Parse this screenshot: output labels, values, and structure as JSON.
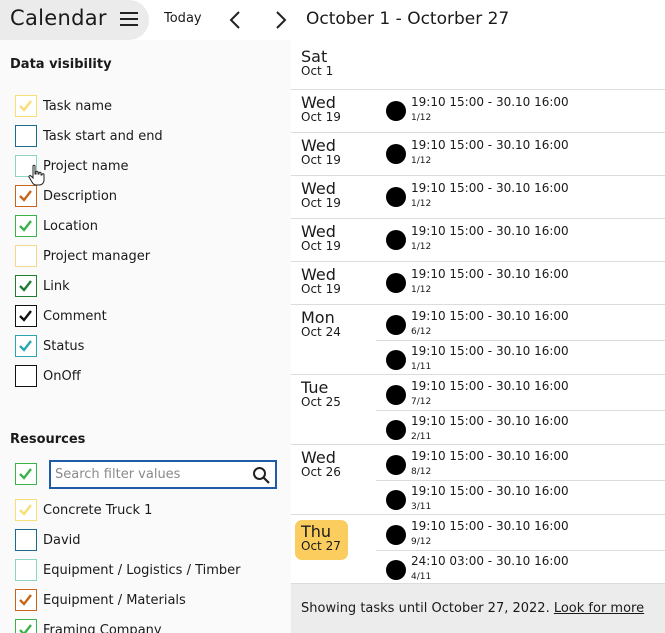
{
  "header": {
    "app_title": "Calendar",
    "today_label": "Today",
    "date_range": "October 1 - Octorber 27",
    "menu_icon": "hamburger-icon",
    "prev_icon": "chevron-left-icon",
    "next_icon": "chevron-right-icon"
  },
  "data_visibility": {
    "title": "Data visibility",
    "items": [
      {
        "label": "Task name",
        "checked": true,
        "color": "#f7df75"
      },
      {
        "label": "Task start and end",
        "checked": false,
        "color": "#1b6b8a"
      },
      {
        "label": "Project name",
        "checked": false,
        "color": "#8ad5c3"
      },
      {
        "label": "Description",
        "checked": true,
        "color": "#c8651b"
      },
      {
        "label": "Location",
        "checked": true,
        "color": "#3bb34a"
      },
      {
        "label": "Project manager",
        "checked": false,
        "color": "#f5d78a"
      },
      {
        "label": "Link",
        "checked": true,
        "color": "#1e7d32"
      },
      {
        "label": "Comment",
        "checked": true,
        "color": "#111111"
      },
      {
        "label": "Status",
        "checked": true,
        "color": "#2aa6b0"
      },
      {
        "label": "OnOff",
        "checked": false,
        "color": "#111111"
      }
    ]
  },
  "resources": {
    "title": "Resources",
    "select_all_checked": true,
    "select_all_color": "#3bb34a",
    "search_placeholder": "Search filter values",
    "search_icon": "search-icon",
    "items": [
      {
        "label": "Concrete Truck 1",
        "checked": true,
        "color": "#f7df75"
      },
      {
        "label": "David",
        "checked": false,
        "color": "#1b6b8a"
      },
      {
        "label": "Equipment / Logistics / Timber",
        "checked": false,
        "color": "#8ad5c3"
      },
      {
        "label": "Equipment / Materials",
        "checked": true,
        "color": "#c8651b"
      },
      {
        "label": "Framing Company",
        "checked": true,
        "color": "#3bb34a"
      }
    ]
  },
  "agenda": {
    "days": [
      {
        "weekday": "Sat",
        "date": "Oct 1",
        "today": false,
        "tasks": []
      },
      {
        "weekday": "Wed",
        "date": "Oct 19",
        "today": false,
        "tasks": [
          {
            "time": "19:10 15:00 - 30.10 16:00",
            "count": "1/12"
          }
        ]
      },
      {
        "weekday": "Wed",
        "date": "Oct 19",
        "today": false,
        "tasks": [
          {
            "time": "19:10 15:00 - 30.10 16:00",
            "count": "1/12"
          }
        ]
      },
      {
        "weekday": "Wed",
        "date": "Oct 19",
        "today": false,
        "tasks": [
          {
            "time": "19:10 15:00 - 30.10 16:00",
            "count": "1/12"
          }
        ]
      },
      {
        "weekday": "Wed",
        "date": "Oct 19",
        "today": false,
        "tasks": [
          {
            "time": "19:10 15:00 - 30.10 16:00",
            "count": "1/12"
          }
        ]
      },
      {
        "weekday": "Wed",
        "date": "Oct 19",
        "today": false,
        "tasks": [
          {
            "time": "19:10 15:00 - 30.10 16:00",
            "count": "1/12"
          }
        ]
      },
      {
        "weekday": "Mon",
        "date": "Oct 24",
        "today": false,
        "tasks": [
          {
            "time": "19:10 15:00 - 30.10 16:00",
            "count": "6/12"
          },
          {
            "time": "19:10 15:00 - 30.10 16:00",
            "count": "1/11"
          }
        ]
      },
      {
        "weekday": "Tue",
        "date": "Oct 25",
        "today": false,
        "tasks": [
          {
            "time": "19:10 15:00 - 30.10 16:00",
            "count": "7/12"
          },
          {
            "time": "19:10 15:00 - 30.10 16:00",
            "count": "2/11"
          }
        ]
      },
      {
        "weekday": "Wed",
        "date": "Oct 26",
        "today": false,
        "tasks": [
          {
            "time": "19:10 15:00 - 30.10 16:00",
            "count": "8/12"
          },
          {
            "time": "19:10 15:00 - 30.10 16:00",
            "count": "3/11"
          }
        ]
      },
      {
        "weekday": "Thu",
        "date": "Oct 27",
        "today": true,
        "tasks": [
          {
            "time": "19:10 15:00 - 30.10 16:00",
            "count": "9/12"
          },
          {
            "time": "24:10 03:00 - 30.10 16:00",
            "count": "4/11"
          }
        ]
      }
    ],
    "today_color": "#fbcd5e",
    "dot_color": "#000000"
  },
  "footer": {
    "text": "Showing tasks until October 27, 2022.",
    "link": "Look for more"
  }
}
